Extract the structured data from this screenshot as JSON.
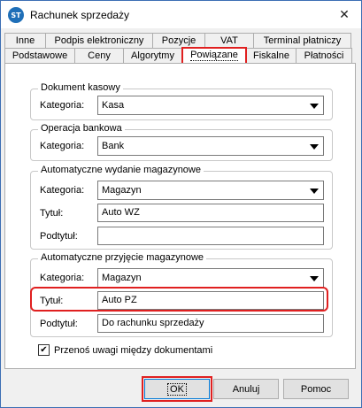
{
  "window": {
    "title": "Rachunek sprzedaży",
    "app_icon_text": "ST",
    "close_symbol": "✕"
  },
  "tabs_back": [
    "Inne",
    "Podpis elektroniczny",
    "Pozycje",
    "VAT",
    "Terminal płatniczy"
  ],
  "tabs_front": [
    "Podstawowe",
    "Ceny",
    "Algorytmy",
    "Powiązane",
    "Fiskalne",
    "Płatności"
  ],
  "active_tab": "Powiązane",
  "groups": {
    "cash": {
      "title": "Dokument kasowy",
      "category_label": "Kategoria:",
      "category_value": "Kasa"
    },
    "bank": {
      "title": "Operacja bankowa",
      "category_label": "Kategoria:",
      "category_value": "Bank"
    },
    "issue": {
      "title": "Automatyczne wydanie magazynowe",
      "category_label": "Kategoria:",
      "category_value": "Magazyn",
      "title_label": "Tytuł:",
      "title_value": "Auto WZ",
      "subtitle_label": "Podtytuł:",
      "subtitle_value": ""
    },
    "receipt": {
      "title": "Automatyczne przyjęcie magazynowe",
      "category_label": "Kategoria:",
      "category_value": "Magazyn",
      "title_label": "Tytuł:",
      "title_value": "Auto PZ",
      "subtitle_label": "Podtytuł:",
      "subtitle_value": "Do rachunku sprzedaży"
    }
  },
  "transfer_notes": {
    "label": "Przenoś uwagi między dokumentami",
    "checked": true,
    "check_symbol": "✔"
  },
  "buttons": {
    "ok": "OK",
    "cancel": "Anuluj",
    "help": "Pomoc"
  },
  "colors": {
    "highlight": "#e02020",
    "title_bar": "#ffffff",
    "dialog_bg": "#f0f0f0"
  }
}
